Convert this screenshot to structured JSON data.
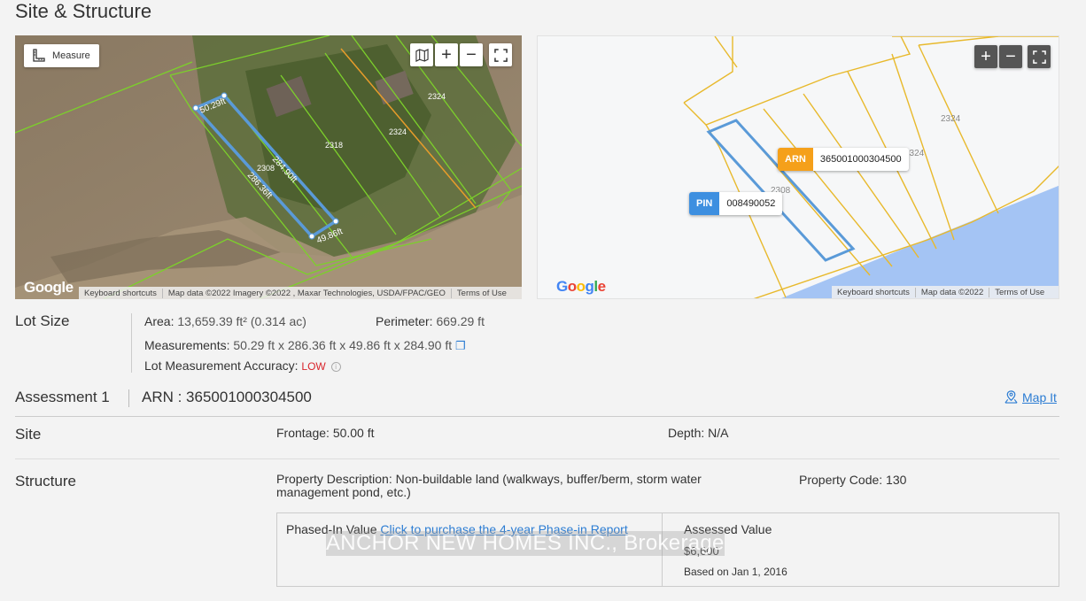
{
  "page": {
    "title": "Site & Structure"
  },
  "satellite_map": {
    "measure_label": "Measure",
    "parcel_labels": [
      "2324",
      "2324",
      "2318",
      "2308"
    ],
    "measure_labels": [
      "50.29ft",
      "284.90ft",
      "286.36ft",
      "49.86ft"
    ],
    "google_logo": "Google",
    "attribution": [
      "Keyboard shortcuts",
      "Map data ©2022 Imagery ©2022 , Maxar Technologies, USDA/FPAC/GEO",
      "Terms of Use"
    ]
  },
  "parcel_map": {
    "parcel_labels": [
      "2324",
      "2324",
      "2308"
    ],
    "arn_tag": {
      "key": "ARN",
      "value": "365001000304500",
      "color": "#f5a01a"
    },
    "pin_tag": {
      "key": "PIN",
      "value": "008490052",
      "color": "#3d8fe0"
    },
    "google_logo": "Google",
    "attribution": [
      "Keyboard shortcuts",
      "Map data ©2022",
      "Terms of Use"
    ]
  },
  "lot_size": {
    "label": "Lot Size",
    "area_label": "Area:",
    "area_value": "13,659.39 ft² (0.314 ac)",
    "perimeter_label": "Perimeter:",
    "perimeter_value": "669.29 ft",
    "measurements_label": "Measurements:",
    "measurements_value": "50.29 ft x 286.36 ft x 49.86 ft x 284.90 ft",
    "accuracy_label": "Lot Measurement Accuracy:",
    "accuracy_value": "LOW"
  },
  "assessment": {
    "title": "Assessment 1",
    "arn": "ARN : 365001000304500",
    "map_it": "Map It"
  },
  "site": {
    "label": "Site",
    "frontage": "Frontage: 50.00 ft",
    "depth": "Depth: N/A"
  },
  "structure": {
    "label": "Structure",
    "description_line1": "Property Description: Non-buildable land (walkways, buffer/berm, storm water",
    "description_line2": "management pond, etc.)",
    "property_code": "Property Code: 130"
  },
  "values": {
    "phased_in_label": "Phased-In Value",
    "phased_in_link": "Click to purchase the 4-year Phase-in Report",
    "assessed_label": "Assessed Value",
    "assessed_amount": "$6,600",
    "based_on": "Based on Jan 1, 2016"
  },
  "watermark": "ANCHOR NEW HOMES INC., Brokerage",
  "colors": {
    "link": "#2b7cd3",
    "low": "#d9242b",
    "parcel_line": "#e8b92c",
    "lot_outline": "#5a9ad8",
    "water": "#a4c4f4"
  }
}
